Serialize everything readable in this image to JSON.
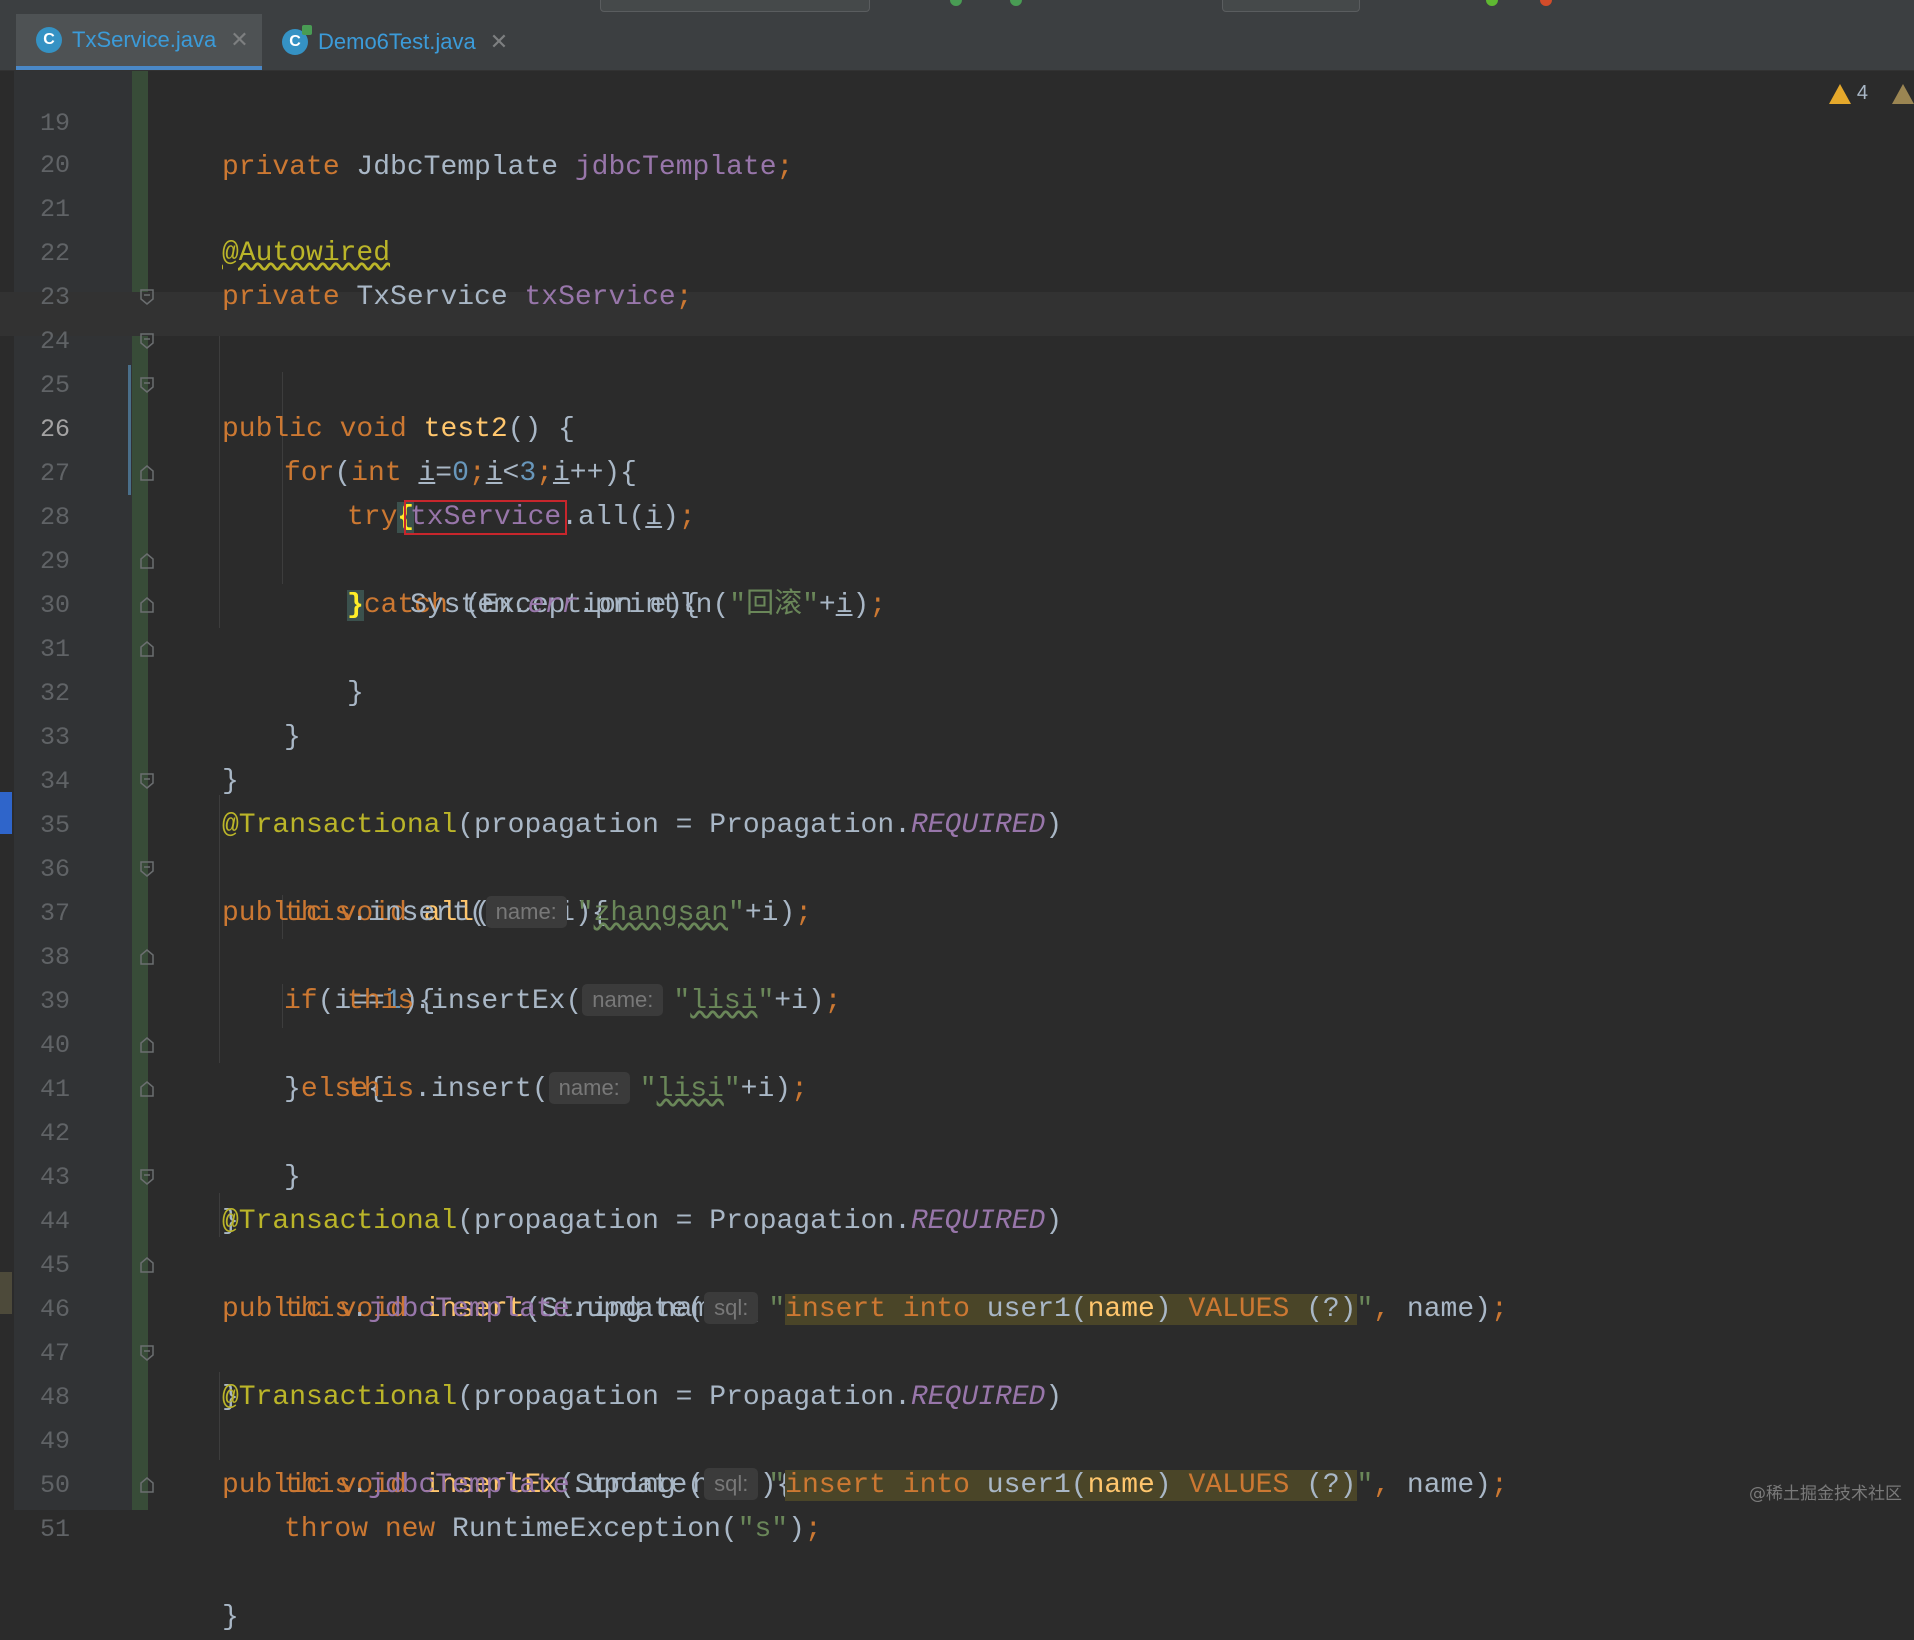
{
  "tabs": [
    {
      "label": "TxService.java",
      "icon": "class-icon",
      "active": true
    },
    {
      "label": "Demo6Test.java",
      "icon": "test-class-icon",
      "active": false
    }
  ],
  "inspections": {
    "warnings_count": "4"
  },
  "current_line": "26",
  "watermark": "@稀土掘金技术社区",
  "lines": {
    "l19": {
      "n": "19",
      "t1": "private",
      "t2": " JdbcTemplate ",
      "t3": "jdbcTemplate",
      "t4": ";"
    },
    "l20": {
      "n": "20"
    },
    "l21": {
      "n": "21",
      "t1": "@Autowired"
    },
    "l22": {
      "n": "22",
      "t1": "private",
      "t2": " TxService ",
      "t3": "txService",
      "t4": ";"
    },
    "l23": {
      "n": "23"
    },
    "l24": {
      "n": "24",
      "t1": "public void ",
      "t2": "test2",
      "t3": "() {"
    },
    "l25": {
      "n": "25",
      "t1": "for",
      "t2": "(",
      "t3": "int ",
      "t4": "i",
      "t5": "=",
      "t6": "0",
      "t7": ";",
      "t8": "i",
      "t9": "<",
      "t10": "3",
      "t11": ";",
      "t12": "i",
      "t13": "++){"
    },
    "l26": {
      "n": "26",
      "t1": "try",
      "t2": "{"
    },
    "l27": {
      "n": "27",
      "t1": "txService",
      "t2": ".all(",
      "t3": "i",
      "t4": ")",
      "t5": ";"
    },
    "l28": {
      "n": "28",
      "t1": "}",
      "t2": "catch ",
      "t3": "(Exception e){"
    },
    "l29": {
      "n": "29",
      "t1": "System.",
      "t2": "err",
      "t3": ".println(",
      "t4": "\"回滚\"",
      "t5": "+",
      "t6": "i",
      "t7": ")",
      "t8": ";"
    },
    "l30": {
      "n": "30",
      "t1": "}"
    },
    "l31": {
      "n": "31",
      "t1": "}"
    },
    "l32": {
      "n": "32",
      "t1": "}"
    },
    "l33": {
      "n": "33"
    },
    "l34": {
      "n": "34",
      "t1": "@Transactional",
      "t2": "(propagation = Propagation.",
      "t3": "REQUIRED",
      "t4": ")"
    },
    "l35": {
      "n": "35",
      "t1": "public void ",
      "t2": "all",
      "t3": "(",
      "t4": "int ",
      "t5": "i){"
    },
    "l36": {
      "n": "36",
      "t1": "this",
      "t2": ".insert(",
      "hint": "name:",
      "t3": "\"",
      "t4": "zhangsan",
      "t5": "\"",
      "t6": "+i)",
      "t7": ";"
    },
    "l37": {
      "n": "37",
      "t1": "if",
      "t2": "(i==",
      "t3": "1",
      "t4": "){"
    },
    "l38": {
      "n": "38",
      "t1": "this",
      "t2": ".insertEx(",
      "hint": "name:",
      "t3": "\"",
      "t4": "lisi",
      "t5": "\"",
      "t6": "+i)",
      "t7": ";"
    },
    "l39": {
      "n": "39",
      "t1": "}",
      "t2": "else",
      "t3": "{"
    },
    "l40": {
      "n": "40",
      "t1": "this",
      "t2": ".insert(",
      "hint": "name:",
      "t3": "\"",
      "t4": "lisi",
      "t5": "\"",
      "t6": "+i)",
      "t7": ";"
    },
    "l41": {
      "n": "41",
      "t1": "}"
    },
    "l42": {
      "n": "42",
      "t1": "}"
    },
    "l43": {
      "n": "43",
      "t1": "@Transactional",
      "t2": "(propagation = Propagation.",
      "t3": "REQUIRED",
      "t4": ")"
    },
    "l44": {
      "n": "44",
      "t1": "public void ",
      "t2": "insert",
      "t3": "(String name){"
    },
    "l45": {
      "n": "45",
      "t1": "this",
      "t2": ".",
      "t3": "jdbcTemplate",
      "t4": ".update(",
      "hint": "sql:",
      "t5": "\"",
      "s1": "insert into ",
      "s2": "user1(",
      "s3": "name",
      "s4": ") ",
      "s5": "VALUES ",
      "s6": "(?)",
      "t6": "\"",
      "t7": ", ",
      "t8": "name)",
      "t9": ";"
    },
    "l46": {
      "n": "46",
      "t1": "}"
    },
    "l47": {
      "n": "47",
      "t1": "@Transactional",
      "t2": "(propagation = Propagation.",
      "t3": "REQUIRED",
      "t4": ")"
    },
    "l48": {
      "n": "48",
      "t1": "public void ",
      "t2": "insertEx",
      "t3": "(String name){"
    },
    "l49": {
      "n": "49",
      "t1": "this",
      "t2": ".",
      "t3": "jdbcTemplate",
      "t4": ".update(",
      "hint": "sql:",
      "t5": "\"",
      "s1": "insert into ",
      "s2": "user1(",
      "s3": "name",
      "s4": ") ",
      "s5": "VALUES ",
      "s6": "(?)",
      "t6": "\"",
      "t7": ", ",
      "t8": "name)",
      "t9": ";"
    },
    "l50": {
      "n": "50",
      "t1": "throw new ",
      "t2": "RuntimeException(",
      "t3": "\"s\"",
      "t4": ")",
      "t5": ";"
    },
    "l51": {
      "n": "51",
      "t1": "}"
    }
  }
}
